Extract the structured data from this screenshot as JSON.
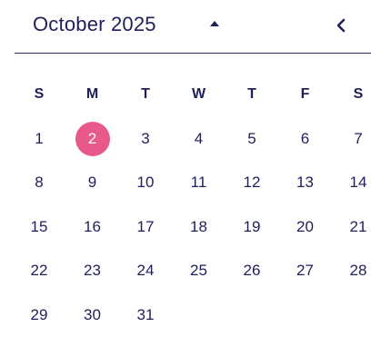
{
  "calendar": {
    "month_label": "October 2025",
    "weekdays": [
      "S",
      "M",
      "T",
      "W",
      "T",
      "F",
      "S"
    ],
    "days": [
      "1",
      "2",
      "3",
      "4",
      "5",
      "6",
      "7",
      "8",
      "9",
      "10",
      "11",
      "12",
      "13",
      "14",
      "15",
      "16",
      "17",
      "18",
      "19",
      "20",
      "21",
      "22",
      "23",
      "24",
      "25",
      "26",
      "27",
      "28",
      "29",
      "30",
      "31"
    ],
    "selected_day": "2",
    "colors": {
      "text": "#1f1f5c",
      "selected_bg": "#e8588a",
      "selected_text": "#ffffff"
    },
    "icons": {
      "toggle": "caret-up-icon",
      "prev": "chevron-left-icon"
    }
  }
}
